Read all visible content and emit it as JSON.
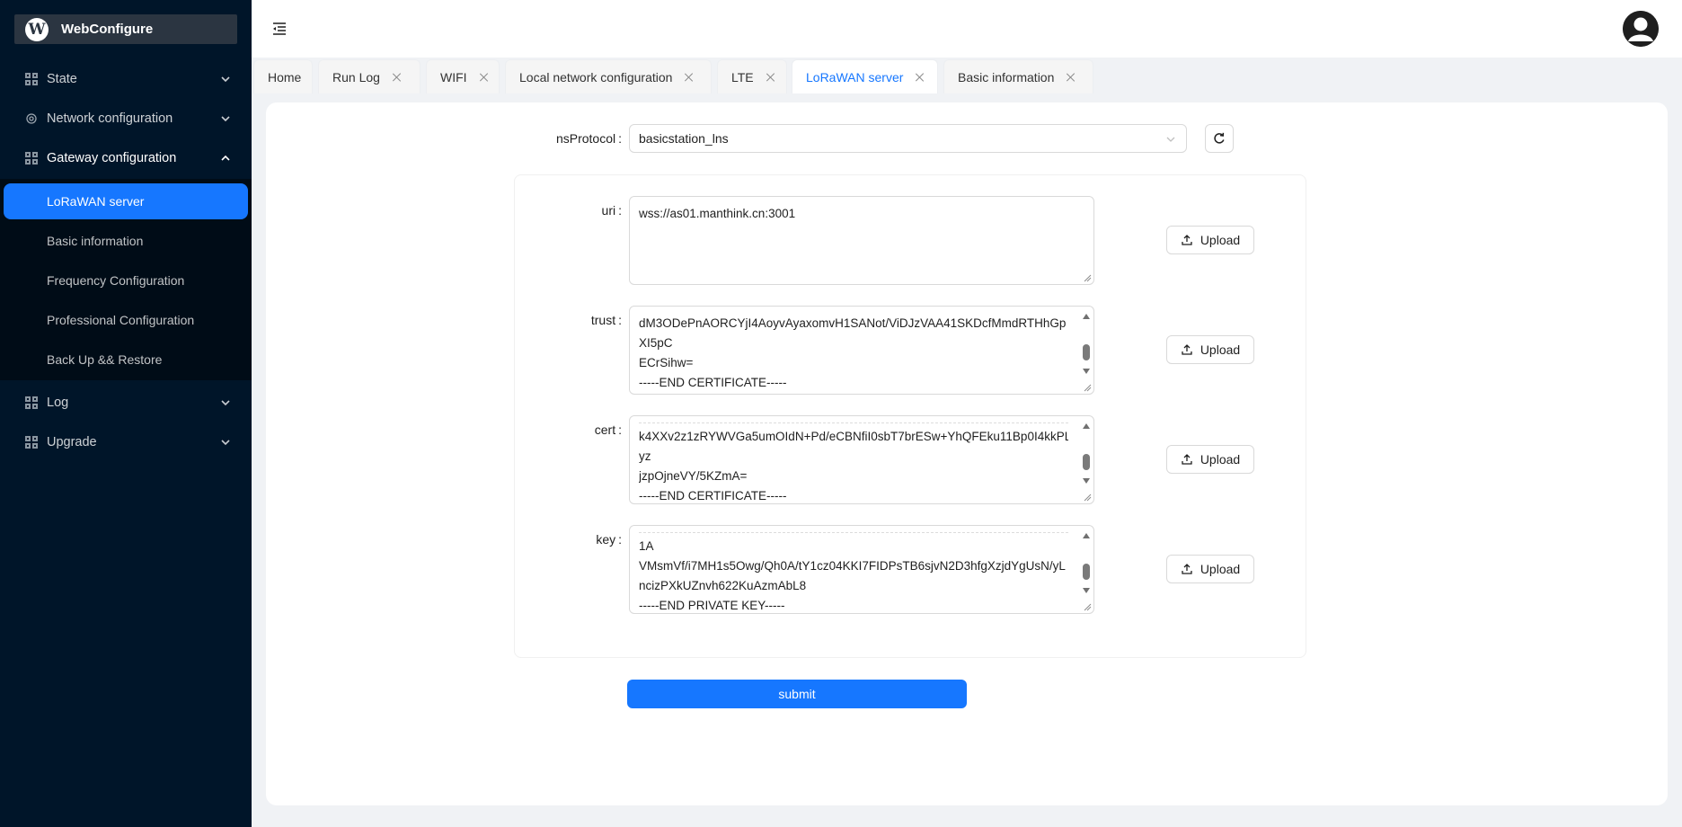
{
  "app": {
    "title": "WebConfigure",
    "logo_letter": "W"
  },
  "sidebar": {
    "menu": [
      {
        "label": "State",
        "icon": "grid-icon",
        "expanded": false
      },
      {
        "label": "Network configuration",
        "icon": "gear-icon",
        "expanded": false
      },
      {
        "label": "Gateway configuration",
        "icon": "grid-icon",
        "expanded": true
      },
      {
        "label": "Log",
        "icon": "grid-icon",
        "expanded": false
      },
      {
        "label": "Upgrade",
        "icon": "grid-icon",
        "expanded": false
      }
    ],
    "gateway_submenu": [
      {
        "label": "LoRaWAN server",
        "active": true
      },
      {
        "label": "Basic information",
        "active": false
      },
      {
        "label": "Frequency Configuration",
        "active": false
      },
      {
        "label": "Professional Configuration",
        "active": false
      },
      {
        "label": "Back Up && Restore",
        "active": false
      }
    ]
  },
  "tabs": [
    {
      "label": "Home",
      "closable": false,
      "active": false
    },
    {
      "label": "Run Log",
      "closable": true,
      "active": false
    },
    {
      "label": "WIFI",
      "closable": true,
      "active": false
    },
    {
      "label": "Local network configuration",
      "closable": true,
      "active": false
    },
    {
      "label": "LTE",
      "closable": true,
      "active": false
    },
    {
      "label": "LoRaWAN server",
      "closable": true,
      "active": true
    },
    {
      "label": "Basic information",
      "closable": true,
      "active": false
    }
  ],
  "form": {
    "ns_protocol": {
      "label": "nsProtocol",
      "value": "basicstation_lns"
    },
    "uri": {
      "label": "uri",
      "lines": [
        "wss://as01.manthink.cn:3001"
      ]
    },
    "trust": {
      "label": "trust",
      "lines": [
        "dM3ODePnAORCYjI4AoyvAyaxomvH1SANot/ViDJzVAA41SKDcfMmdRTHhGp",
        "XI5pC",
        "ECrSihw=",
        "-----END CERTIFICATE-----"
      ]
    },
    "cert": {
      "label": "cert",
      "lines": [
        "k4XXv2z1zRYWVGa5umOIdN+Pd/eCBNfiI0sbT7brESw+YhQFEku11Bp0I4kkPL",
        "yz",
        "jzpOjneVY/5KZmA=",
        "-----END CERTIFICATE-----"
      ]
    },
    "key": {
      "label": "key",
      "lines": [
        "1A",
        "VMsmVf/i7MH1s5Owg/Qh0A/tY1cz04KKI7FIDPsTB6sjvN2D3hfgXzjdYgUsN/yL",
        "ncizPXkUZnvh622KuAzmAbL8",
        "-----END PRIVATE KEY-----"
      ]
    },
    "label_colon": ":",
    "upload_label": "Upload",
    "submit_label": "submit"
  },
  "colors": {
    "sidebar_bg": "#001529",
    "accent": "#1677ff",
    "page_bg": "#f0f2f5"
  }
}
